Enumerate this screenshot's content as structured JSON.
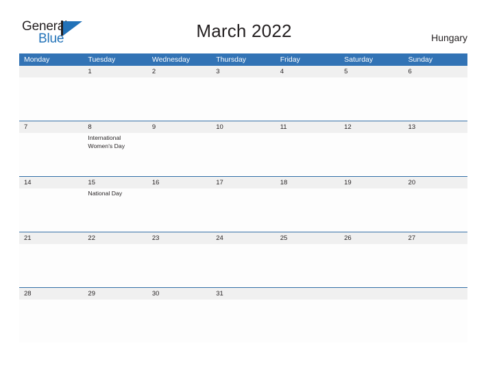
{
  "brand": {
    "name_part1": "General",
    "name_part2": "Blue",
    "logo_icon": "triangle-flag-icon",
    "accent_color": "#2272b8"
  },
  "header": {
    "title": "March 2022",
    "country": "Hungary"
  },
  "theme": {
    "header_blue": "#3273b5",
    "row_line_blue": "#2f6ca5",
    "date_band_gray": "#f0f0f0",
    "cell_white": "#fdfdfd",
    "text_dark": "#231f20"
  },
  "calendar": {
    "month": "March",
    "year": "2022",
    "weekday_headers": [
      "Monday",
      "Tuesday",
      "Wednesday",
      "Thursday",
      "Friday",
      "Saturday",
      "Sunday"
    ],
    "weeks": [
      [
        {
          "day": "",
          "event": ""
        },
        {
          "day": "1",
          "event": ""
        },
        {
          "day": "2",
          "event": ""
        },
        {
          "day": "3",
          "event": ""
        },
        {
          "day": "4",
          "event": ""
        },
        {
          "day": "5",
          "event": ""
        },
        {
          "day": "6",
          "event": ""
        }
      ],
      [
        {
          "day": "7",
          "event": ""
        },
        {
          "day": "8",
          "event": "International Women's Day"
        },
        {
          "day": "9",
          "event": ""
        },
        {
          "day": "10",
          "event": ""
        },
        {
          "day": "11",
          "event": ""
        },
        {
          "day": "12",
          "event": ""
        },
        {
          "day": "13",
          "event": ""
        }
      ],
      [
        {
          "day": "14",
          "event": ""
        },
        {
          "day": "15",
          "event": "National Day"
        },
        {
          "day": "16",
          "event": ""
        },
        {
          "day": "17",
          "event": ""
        },
        {
          "day": "18",
          "event": ""
        },
        {
          "day": "19",
          "event": ""
        },
        {
          "day": "20",
          "event": ""
        }
      ],
      [
        {
          "day": "21",
          "event": ""
        },
        {
          "day": "22",
          "event": ""
        },
        {
          "day": "23",
          "event": ""
        },
        {
          "day": "24",
          "event": ""
        },
        {
          "day": "25",
          "event": ""
        },
        {
          "day": "26",
          "event": ""
        },
        {
          "day": "27",
          "event": ""
        }
      ],
      [
        {
          "day": "28",
          "event": ""
        },
        {
          "day": "29",
          "event": ""
        },
        {
          "day": "30",
          "event": ""
        },
        {
          "day": "31",
          "event": ""
        },
        {
          "day": "",
          "event": ""
        },
        {
          "day": "",
          "event": ""
        },
        {
          "day": "",
          "event": ""
        }
      ]
    ]
  }
}
